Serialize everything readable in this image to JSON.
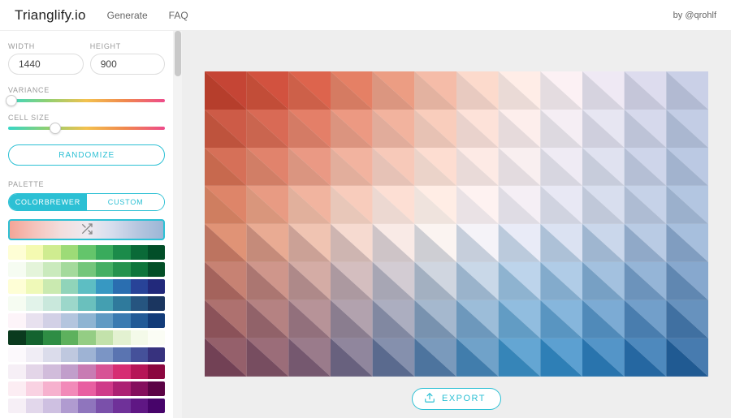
{
  "header": {
    "brand": "Trianglify.io",
    "nav": {
      "generate": "Generate",
      "faq": "FAQ"
    },
    "byline": "by @qrohlf"
  },
  "sidebar": {
    "width": {
      "label": "WIDTH",
      "value": "1440"
    },
    "height": {
      "label": "HEIGHT",
      "value": "900"
    },
    "variance": {
      "label": "VARIANCE",
      "pct": 2
    },
    "cellsize": {
      "label": "CELL SIZE",
      "pct": 30
    },
    "randomize_label": "RANDOMIZE",
    "palette": {
      "label": "PALETTE",
      "tabs": {
        "colorbrewer": "COLORBREWER",
        "custom": "CUSTOM",
        "active": "colorbrewer"
      },
      "shuffle_gradient": [
        "#f4a597",
        "#f4c4bd",
        "#f3dedd",
        "#efeaf0",
        "#d6dded",
        "#b6c6df",
        "#9cb6d6"
      ],
      "rows": [
        [
          "#fefed5",
          "#f4fab1",
          "#cfec90",
          "#9ddb77",
          "#64c56b",
          "#39ab5c",
          "#1b8b4a",
          "#0a6a38",
          "#024e28"
        ],
        [
          "#f6fcf2",
          "#e4f4da",
          "#caeabd",
          "#a4da9c",
          "#74c67b",
          "#45af63",
          "#26934e",
          "#0e753b",
          "#034f27"
        ],
        [
          "#fefed6",
          "#eff9b8",
          "#caeab0",
          "#90d4b9",
          "#5dbec3",
          "#3798c2",
          "#2a6eb0",
          "#284398",
          "#22297b"
        ],
        [
          "#f6fcf2",
          "#e2f3ea",
          "#c9e8dc",
          "#9cd7ca",
          "#6ac0bd",
          "#449fb1",
          "#2f7a9c",
          "#265580",
          "#1b3660"
        ],
        [
          "#fdf4f9",
          "#e8e1ef",
          "#d2d0e6",
          "#b4c5de",
          "#8eb4d2",
          "#609ac3",
          "#3b7bb1",
          "#225a97",
          "#123b79"
        ],
        [
          "#0a3a1e",
          "#14632f",
          "#2e8d44",
          "#5db15d",
          "#94cd84",
          "#c3e2ab",
          "#e3f1d1",
          "#f4fae9",
          "#fbfdf5"
        ],
        [
          "#fcf9fc",
          "#f0edf5",
          "#dbdceb",
          "#bfc8df",
          "#9eb3d4",
          "#7b95c5",
          "#5a74b1",
          "#45519a",
          "#37327e"
        ],
        [
          "#f6eff6",
          "#e3d5e8",
          "#d1bcdb",
          "#c19ecb",
          "#c87bb3",
          "#d75395",
          "#d62d73",
          "#b61557",
          "#8b073f"
        ],
        [
          "#fcedf3",
          "#f9d2e2",
          "#f6b1ce",
          "#f28ab9",
          "#e85fa1",
          "#cf3b89",
          "#ac2173",
          "#840f5d",
          "#5b0345"
        ],
        [
          "#f6eff6",
          "#e2d7eb",
          "#cec0e1",
          "#b09bd0",
          "#8f75bd",
          "#7a50aa",
          "#6f3199",
          "#5f1784",
          "#47046a"
        ]
      ]
    }
  },
  "export_label": "EXPORT",
  "preview": {
    "cols": 12,
    "rows": 8,
    "palette_top": [
      "#b23225",
      "#c13d2c",
      "#cf4d36",
      "#d86a4e",
      "#e08a6f",
      "#eaae98",
      "#f2cfc2",
      "#f8e6e0",
      "#f2e9ed",
      "#e1dce9",
      "#cdcee1",
      "#b9c1d9"
    ],
    "palette_mid": [
      "#d6805f",
      "#e09a7e",
      "#eab7a1",
      "#f2d2c4",
      "#f7e5de",
      "#faf0eb",
      "#f4eef1",
      "#e6e5ef",
      "#d5dae9",
      "#c2cde1",
      "#aec0da",
      "#9ab3d2"
    ],
    "palette_bot": [
      "#73425a",
      "#7c4e63",
      "#7d5a71",
      "#6f6381",
      "#5e6d92",
      "#4f78a3",
      "#4182b4",
      "#368bc2",
      "#2e83bd",
      "#2a76b1",
      "#2667a2",
      "#235891"
    ]
  }
}
